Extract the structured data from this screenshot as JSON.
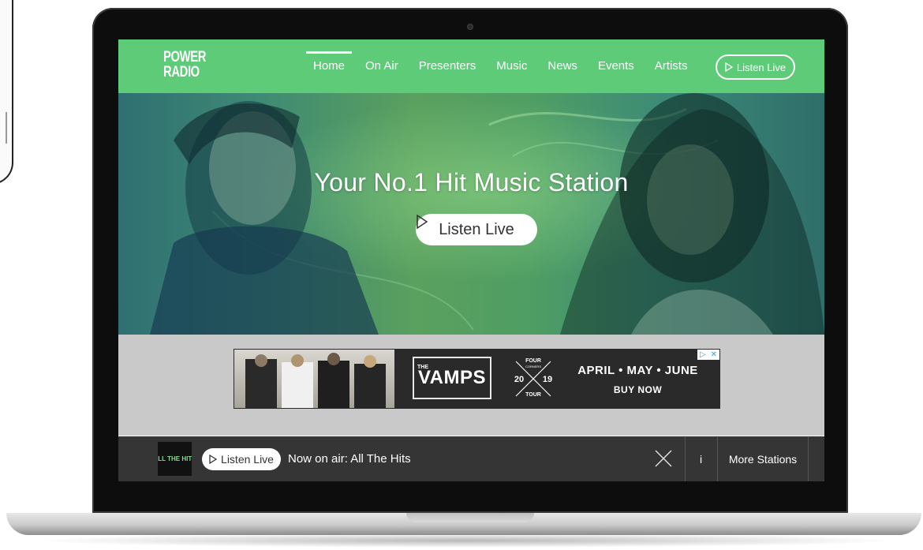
{
  "brand": {
    "line1": "POWER",
    "line2": "RADIO"
  },
  "nav": {
    "items": [
      {
        "label": "Home",
        "active": true
      },
      {
        "label": "On Air"
      },
      {
        "label": "Presenters"
      },
      {
        "label": "Music"
      },
      {
        "label": "News"
      },
      {
        "label": "Events"
      },
      {
        "label": "Artists"
      }
    ],
    "listen_live": "Listen Live"
  },
  "hero": {
    "title": "Your No.1 Hit Music Station",
    "listen_live": "Listen Live"
  },
  "ad": {
    "band_prefix": "THE",
    "band_name": "VAMPS",
    "tour_top": "FOUR",
    "tour_sub": "CORNERS",
    "tour_year_left": "20",
    "tour_year_right": "19",
    "tour_bottom": "TOUR",
    "dates": "APRIL • MAY • JUNE",
    "cta": "BUY NOW"
  },
  "player": {
    "thumb_text": "ALL THE HITS",
    "listen_live": "Listen Live",
    "now_on_air": "Now on air: All The Hits",
    "info": "i",
    "more_stations": "More Stations"
  },
  "colors": {
    "nav_green": "#5ecb79",
    "player_bg": "#353535",
    "ad_band_bg": "#c9c9c9"
  },
  "icons": {
    "play": "play-outline-icon",
    "close": "close-icon",
    "ad_choices": "ad-choices-icon"
  }
}
